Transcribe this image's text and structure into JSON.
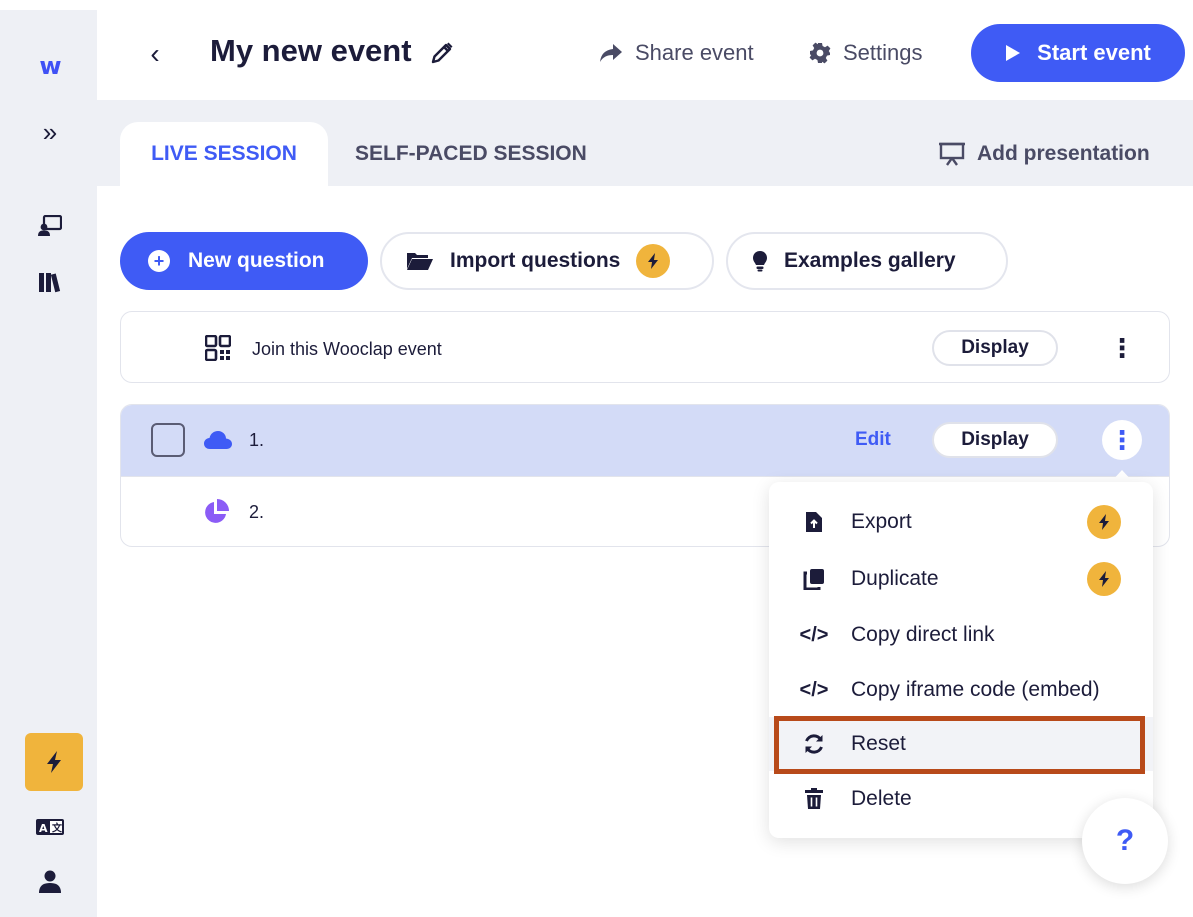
{
  "sidebar": {
    "logo_text": "w",
    "expand_glyph": "»",
    "items": [
      {
        "icon": "presentation-icon"
      },
      {
        "icon": "library-icon"
      }
    ],
    "bottom": [
      {
        "icon": "bolt-icon",
        "color": "#f0b43c"
      },
      {
        "icon": "translate-icon"
      },
      {
        "icon": "user-icon"
      }
    ]
  },
  "header": {
    "back_glyph": "‹",
    "title": "My new event",
    "share_label": "Share event",
    "settings_label": "Settings",
    "start_label": "Start event"
  },
  "tabs": {
    "live": "LIVE SESSION",
    "self_paced": "SELF-PACED SESSION",
    "add_presentation": "Add presentation"
  },
  "actions": {
    "new_question": "New question",
    "import_questions": "Import questions",
    "examples_gallery": "Examples gallery"
  },
  "rows": {
    "join": {
      "label": "Join this Wooclap event",
      "display": "Display"
    },
    "questions": [
      {
        "number": "1.",
        "edit": "Edit",
        "display": "Display",
        "icon": "word-cloud-icon"
      },
      {
        "number": "2.",
        "icon": "poll-icon"
      }
    ]
  },
  "menu": {
    "items": [
      {
        "label": "Export",
        "icon": "export-icon",
        "premium": true
      },
      {
        "label": "Duplicate",
        "icon": "duplicate-icon",
        "premium": true
      },
      {
        "label": "Copy direct link",
        "icon": "code-icon",
        "glyph": "</>"
      },
      {
        "label": "Copy iframe code (embed)",
        "icon": "code-icon",
        "glyph": "</>"
      },
      {
        "label": "Reset",
        "icon": "reset-icon"
      },
      {
        "label": "Delete",
        "icon": "trash-icon"
      }
    ]
  },
  "help": {
    "glyph": "?"
  },
  "colors": {
    "accent": "#3f5bf5",
    "premium": "#f0b43c",
    "highlight": "#b84a1a"
  }
}
